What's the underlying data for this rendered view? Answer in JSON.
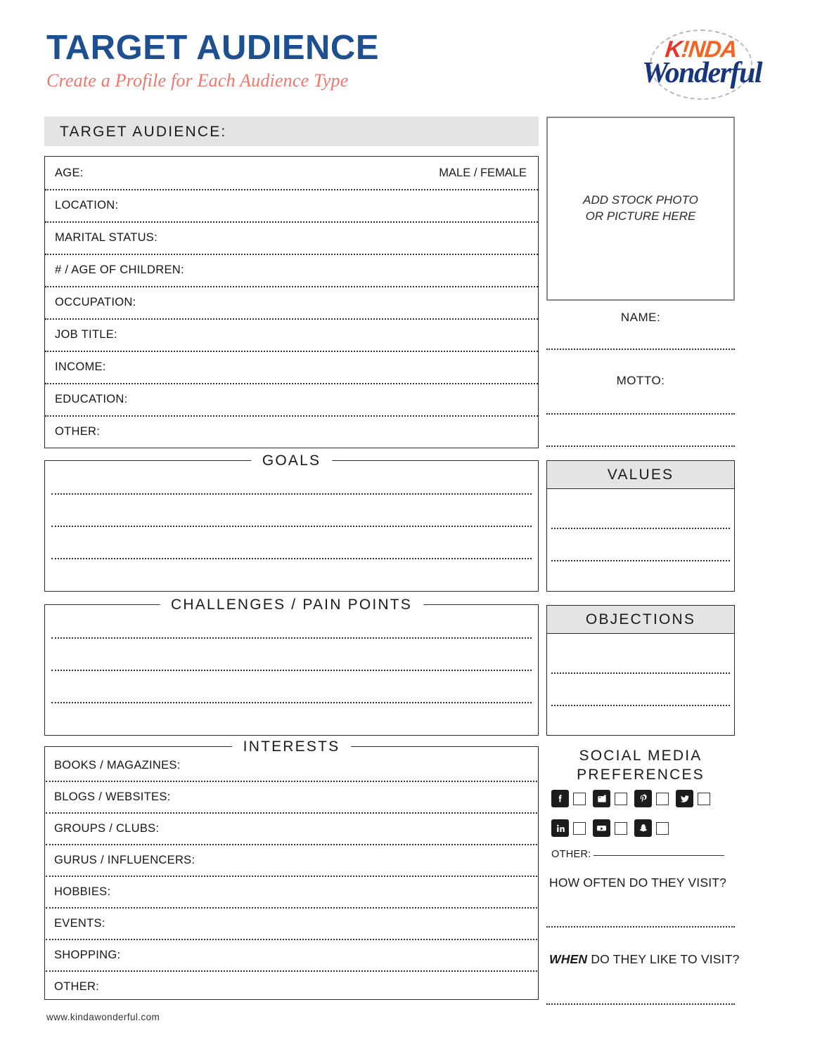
{
  "header": {
    "title": "TARGET AUDIENCE",
    "subtitle": "Create a Profile for Each Audience Type",
    "logo": {
      "top_k": "K",
      "top_rest": "!NDA",
      "bottom": "Wonderful"
    }
  },
  "target_audience": {
    "bar_label": "TARGET AUDIENCE:",
    "age_label": "AGE:",
    "gender_label": "MALE / FEMALE",
    "rows": [
      {
        "label": "LOCATION:"
      },
      {
        "label": "MARITAL STATUS:"
      },
      {
        "label": "# / AGE OF CHILDREN:"
      },
      {
        "label": "OCCUPATION:"
      },
      {
        "label": "JOB TITLE:"
      },
      {
        "label": "INCOME:"
      },
      {
        "label": "EDUCATION:"
      },
      {
        "label": "OTHER:"
      }
    ]
  },
  "photo": {
    "placeholder_line1": "ADD STOCK PHOTO",
    "placeholder_line2": "OR PICTURE HERE",
    "name_label": "NAME:",
    "motto_label": "MOTTO:"
  },
  "goals": {
    "title": "GOALS"
  },
  "values": {
    "title": "VALUES"
  },
  "challenges": {
    "title": "CHALLENGES / PAIN POINTS"
  },
  "objections": {
    "title": "OBJECTIONS"
  },
  "interests": {
    "title": "INTERESTS",
    "rows": [
      {
        "label": "BOOKS / MAGAZINES:"
      },
      {
        "label": "BLOGS / WEBSITES:"
      },
      {
        "label": "GROUPS / CLUBS:"
      },
      {
        "label": "GURUS / INFLUENCERS:"
      },
      {
        "label": "HOBBIES:"
      },
      {
        "label": "EVENTS:"
      },
      {
        "label": "SHOPPING:"
      },
      {
        "label": "OTHER:"
      }
    ]
  },
  "social": {
    "title_line1": "SOCIAL MEDIA",
    "title_line2": "PREFERENCES",
    "platforms": [
      {
        "name": "facebook",
        "icon": "facebook-icon",
        "checked": false
      },
      {
        "name": "instagram",
        "icon": "instagram-icon",
        "checked": false
      },
      {
        "name": "pinterest",
        "icon": "pinterest-icon",
        "checked": false
      },
      {
        "name": "twitter",
        "icon": "twitter-icon",
        "checked": false
      },
      {
        "name": "linkedin",
        "icon": "linkedin-icon",
        "checked": false
      },
      {
        "name": "youtube",
        "icon": "youtube-icon",
        "checked": false
      },
      {
        "name": "snapchat",
        "icon": "snapchat-icon",
        "checked": false
      }
    ],
    "other_label": "OTHER:",
    "question_1": "HOW OFTEN DO THEY VISIT?",
    "question_2_emphasis": "WHEN",
    "question_2_rest": " DO THEY LIKE TO VISIT?"
  },
  "footer": {
    "website": "www.kindawonderful.com"
  },
  "colors": {
    "title_blue": "#1d4f91",
    "subtitle_coral": "#f0756b",
    "logo_orange": "#f26522",
    "logo_navy": "#17357e",
    "bar_gray": "#e4e4e4",
    "ink": "#1a1a1a",
    "photo_border_gray": "#8a8a8a"
  }
}
